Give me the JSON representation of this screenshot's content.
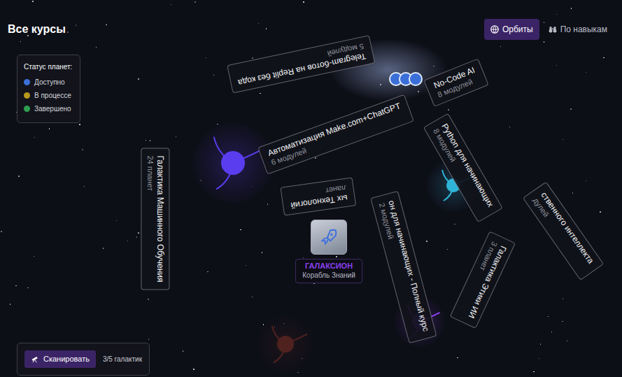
{
  "header": {
    "title": "Все курсы"
  },
  "tabs": [
    {
      "label": "Орбиты",
      "selected": true
    },
    {
      "label": "По навыкам",
      "selected": false
    }
  ],
  "legend": {
    "title": "Статус планет:",
    "items": [
      {
        "label": "Доступно",
        "color": "#3b6fd8"
      },
      {
        "label": "В процессе",
        "color": "#b89a1c"
      },
      {
        "label": "Завершено",
        "color": "#2e9e4f"
      }
    ]
  },
  "planets": [
    {
      "color": "#5b3df0"
    },
    {
      "color": "#2fb4d8"
    },
    {
      "color": "#8a3ff0"
    },
    {
      "color": "#a23a2a"
    }
  ],
  "galaxies": [
    {
      "name": "Галактика Машинного Обучения",
      "count": "24 планет"
    },
    {
      "name": "Галактика Этики ИИ",
      "count": "3 планет"
    },
    {
      "name": "ых Технологий",
      "count": "ланет"
    }
  ],
  "courses": [
    {
      "name": "Telegram-ботов на Replit без кода",
      "count": "5 модулей"
    },
    {
      "name": "Автоматизация Make.com+ChatGPT",
      "count": "6 модулей"
    },
    {
      "name": "No-Code AI",
      "count": "8 модулей"
    },
    {
      "name": "Python для начинающих",
      "count": "8 модулей"
    },
    {
      "name": "ственного интеллекта",
      "count": "дулей"
    },
    {
      "name": "он для начинающих - Полный курс",
      "count": "2 модулей"
    }
  ],
  "ship": {
    "name": "ГАЛАКСИОН",
    "subtitle": "Корабль Знаний"
  },
  "scan": {
    "button": "Сканировать",
    "progress": "3/5 галактик"
  }
}
